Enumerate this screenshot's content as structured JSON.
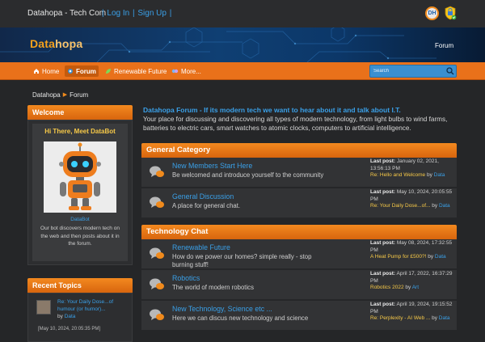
{
  "topbar": {
    "site_name": "Datahopa - Tech Com",
    "login_label": "Log In",
    "signup_label": "Sign Up",
    "badge_text": "DH"
  },
  "banner": {
    "logo_part1": "Data",
    "logo_part2": "hopa",
    "forum_label": "Forum"
  },
  "nav": {
    "items": [
      {
        "label": "Home",
        "icon": "home-icon"
      },
      {
        "label": "Forum",
        "icon": "forum-icon"
      },
      {
        "label": "Renewable Future",
        "icon": "leaf-icon"
      },
      {
        "label": "More...",
        "icon": "more-icon"
      }
    ],
    "search_placeholder": "Search"
  },
  "breadcrumb": {
    "home": "Datahopa",
    "current": "Forum"
  },
  "sidebar": {
    "welcome_title": "Welcome",
    "hi_title": "Hi There, Meet DataBot",
    "bot_name": "DataBot",
    "bot_desc": "Our bot discovers modern tech on the web and then posts about it in the forum.",
    "recent_title": "Recent Topics",
    "recent": {
      "title": "Re: Your Daily Dose...of humour (or humor)...",
      "by": "by",
      "user": "Data",
      "date": "[May 10, 2024, 20:05:35 PM]"
    }
  },
  "intro": {
    "title": "Datahopa Forum - If its modern tech we want to hear about it and talk about I.T.",
    "text": "Your place for discussing and discovering all types of modern technology, from light bulbs to wind farms, batteries to electric cars, smart watches to atomic clocks, computers to artificial intelligence."
  },
  "categories": [
    {
      "title": "General Category",
      "boards": [
        {
          "title": "New Members Start Here",
          "desc": "Be welcomed and introduce yourself to the community",
          "last_label": "Last post:",
          "last_date": "January 02, 2021, 13:56:13 PM",
          "last_topic": "Re: Hello and Welcome",
          "by": "by",
          "last_user": "Data"
        },
        {
          "title": "General Discussion",
          "desc": "A place for general chat.",
          "last_label": "Last post:",
          "last_date": "May 10, 2024, 20:05:55 PM",
          "last_topic": "Re: Your Daily Dose...of...",
          "by": "by",
          "last_user": "Data"
        }
      ]
    },
    {
      "title": "Technology Chat",
      "boards": [
        {
          "title": "Renewable Future",
          "desc": "How do we power our homes?  simple really - stop burning stuff!",
          "last_label": "Last post:",
          "last_date": "May 08, 2024, 17:32:55 PM",
          "last_topic": "A Heat Pump for £500?!",
          "by": "by",
          "last_user": "Data"
        },
        {
          "title": "Robotics",
          "desc": "The world of modern robotics",
          "last_label": "Last post:",
          "last_date": "April 17, 2022, 16:37:29 PM",
          "last_topic": "Robotics 2022",
          "by": "by",
          "last_user": "Art"
        },
        {
          "title": "New Technology, Science etc ...",
          "desc": "Here we can discus new technology and science",
          "last_label": "Last post:",
          "last_date": "April 19, 2024, 19:15:52 PM",
          "last_topic": "Re: Perplexity - AI Web ...",
          "by": "by",
          "last_user": "Data"
        }
      ]
    }
  ],
  "colors": {
    "accent_orange": "#e9711a",
    "link_blue": "#3aa0e8",
    "topic_yellow": "#f7c948",
    "background": "#252628"
  }
}
